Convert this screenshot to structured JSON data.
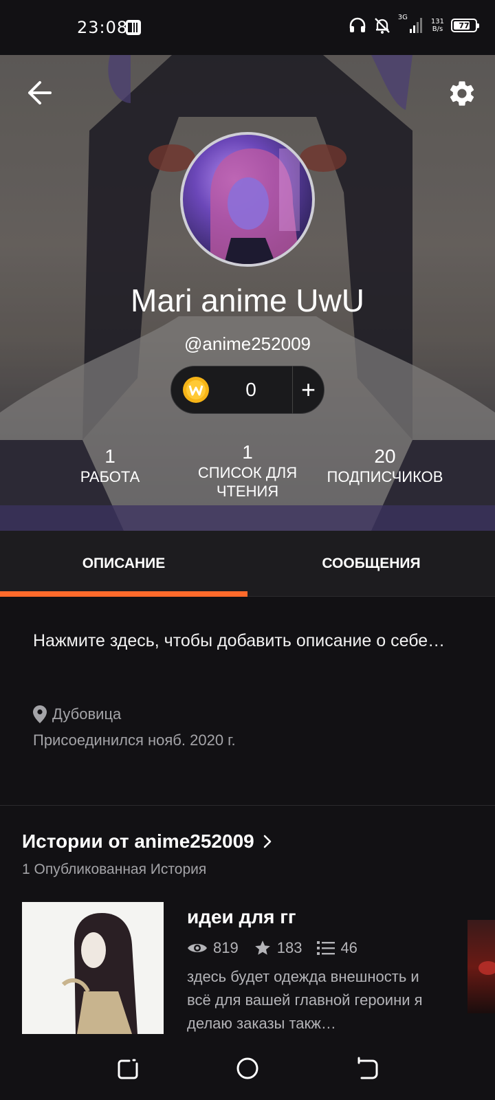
{
  "status_bar": {
    "time": "23:08",
    "network": "3G",
    "speed_value": "131",
    "speed_unit": "B/s",
    "battery": "77",
    "battery_level": 0.77
  },
  "header": {
    "back_icon": "arrow-left-icon",
    "settings_icon": "gear-icon",
    "name": "Mari anime UwU",
    "handle": "@anime252009",
    "coins": {
      "count": "0",
      "add_label": "+"
    }
  },
  "stats": [
    {
      "value": "1",
      "label": "РАБОТА"
    },
    {
      "value": "1",
      "label": "СПИСОК ДЛЯ ЧТЕНИЯ"
    },
    {
      "value": "20",
      "label": "ПОДПИСЧИКОВ"
    }
  ],
  "tabs": [
    {
      "label": "ОПИСАНИЕ",
      "active": true
    },
    {
      "label": "СООБЩЕНИЯ",
      "active": false
    }
  ],
  "about": {
    "description_placeholder": "Нажмите здесь, чтобы добавить описание о себе…",
    "location": "Дубовица",
    "joined": "Присоединился нояб. 2020 г."
  },
  "stories": {
    "title": "Истории от anime252009",
    "count_label": "1 Опубликованная История",
    "items": [
      {
        "title": "идеи для гг",
        "reads": "819",
        "votes": "183",
        "parts": "46",
        "description": "здесь будет одежда внешность и всё для вашей главной героини я делаю заказы такж…"
      }
    ]
  },
  "colors": {
    "accent": "#ff6a2b",
    "background": "#121114",
    "tab_bar": "#1d1c1f",
    "secondary_text": "#a4a4a8"
  }
}
